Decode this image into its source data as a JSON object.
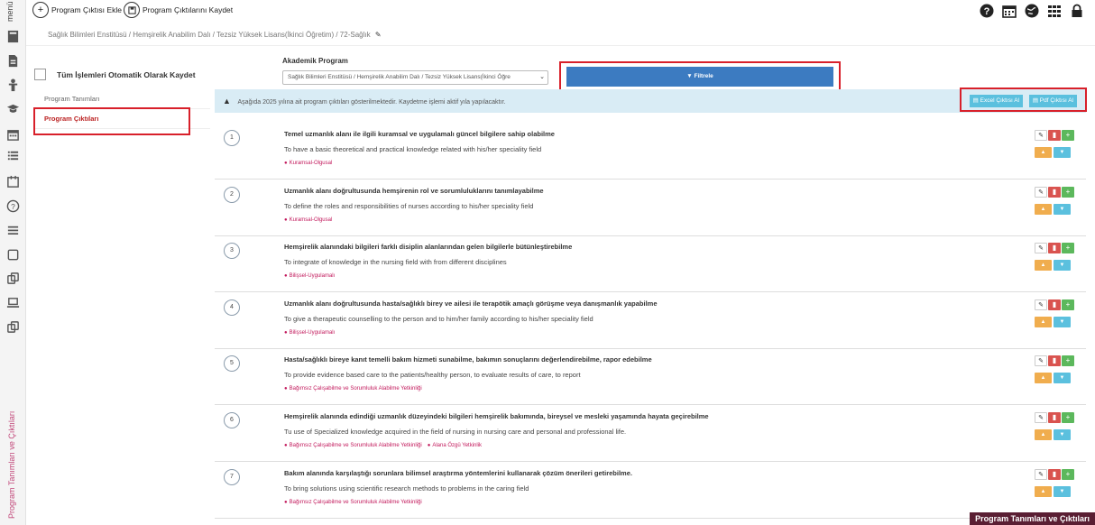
{
  "topbar": {
    "menu_label": "menü",
    "add_button": "Program Çıktısı Ekle",
    "save_button": "Program Çıktılarını Kaydet"
  },
  "breadcrumb": "Sağlık Bilimleri Enstitüsü / Hemşirelik Anabilim Dalı / Tezsiz Yüksek Lisans(İkinci Öğretim) / 72-Sağlık",
  "left": {
    "autosave_label": "Tüm İşlemleri Otomatik Olarak Kaydet",
    "nav": [
      "Program Tanımları",
      "Program Çıktıları"
    ]
  },
  "filter": {
    "label": "Akademik Program",
    "selected": "Sağlık Bilimleri Enstitüsü / Hemşirelik Anabilim Dalı / Tezsiz Yüksek Lisans(İkinci Öğre",
    "button": "Filtrele"
  },
  "banner": {
    "message": "Aşağıda 2025 yılına ait program çıktıları gösterilmektedir. Kaydetme işlemi aktif yıla yapılacaktır.",
    "excel": "Excel Çıktısı Al",
    "pdf": "Pdf Çıktısı Al"
  },
  "outcomes": [
    {
      "num": "1",
      "tr": "Temel uzmanlık alanı ile ilgili kuramsal ve uygulamalı güncel bilgilere sahip olabilme",
      "en": "To have a basic theoretical and practical knowledge related with his/her speciality field",
      "tags": [
        "Kuramsal-Olgusal"
      ]
    },
    {
      "num": "2",
      "tr": "Uzmanlık alanı doğrultusunda hemşirenin rol ve sorumluluklarını tanımlayabilme",
      "en": "To define the roles and responsibilities of nurses according to his/her speciality field",
      "tags": [
        "Kuramsal-Olgusal"
      ]
    },
    {
      "num": "3",
      "tr": "Hemşirelik alanındaki bilgileri farklı disiplin alanlarından gelen bilgilerle bütünleştirebilme",
      "en": "To integrate of knowledge in the nursing field with from different disciplines",
      "tags": [
        "Bilişsel-Uygulamalı"
      ]
    },
    {
      "num": "4",
      "tr": "Uzmanlık alanı doğrultusunda hasta/sağlıklı birey ve ailesi ile terapötik amaçlı görüşme veya danışmanlık yapabilme",
      "en": "To give a therapeutic counselling to the person and to him/her family according to his/her speciality field",
      "tags": [
        "Bilişsel-Uygulamalı"
      ]
    },
    {
      "num": "5",
      "tr": "Hasta/sağlıklı bireye kanıt temelli bakım hizmeti sunabilme, bakımın sonuçlarını değerlendirebilme, rapor edebilme",
      "en": "To provide evidence based care to the patients/healthy person, to evaluate results of care, to report",
      "tags": [
        "Bağımsız Çalışabilme ve Sorumluluk Alabilme Yetkinliği"
      ]
    },
    {
      "num": "6",
      "tr": "Hemşirelik alanında edindiği uzmanlık düzeyindeki bilgileri hemşirelik bakımında, bireysel ve mesleki yaşamında hayata geçirebilme",
      "en": "Tu use of Specialized knowledge acquired in the field of nursing in nursing care and personal and professional life.",
      "tags": [
        "Bağımsız Çalışabilme ve Sorumluluk Alabilme Yetkinliği",
        "Alana Özgü Yetkinlik"
      ]
    },
    {
      "num": "7",
      "tr": "Bakım alanında karşılaştığı sorunlara bilimsel araştırma yöntemlerini kullanarak çözüm önerileri getirebilme.",
      "en": "To bring solutions using scientific research methods to problems in the caring field",
      "tags": [
        "Bağımsız Çalışabilme ve Sorumluluk Alabilme Yetkinliği"
      ]
    }
  ],
  "side_title": "Program Tanımları ve Çıktıları",
  "footer_badge": "Program Tanımları ve Çıktıları",
  "colors": {
    "accent_red": "#d8202a",
    "filter_blue": "#3c7bc1",
    "tag_pink": "#c2185b",
    "banner_bg": "#d9ecf5"
  },
  "icons": {
    "top_right": [
      "help-icon",
      "calendar-icon",
      "globe-icon",
      "apps-grid-icon",
      "lock-icon"
    ],
    "rail": [
      "book-icon",
      "document-icon",
      "person-icon",
      "graduation-cap-icon",
      "calendar-icon",
      "list-icon",
      "calendar-icon",
      "help-icon",
      "menu-icon",
      "square-icon",
      "copy-icon",
      "laptop-icon",
      "copy-icon"
    ]
  }
}
